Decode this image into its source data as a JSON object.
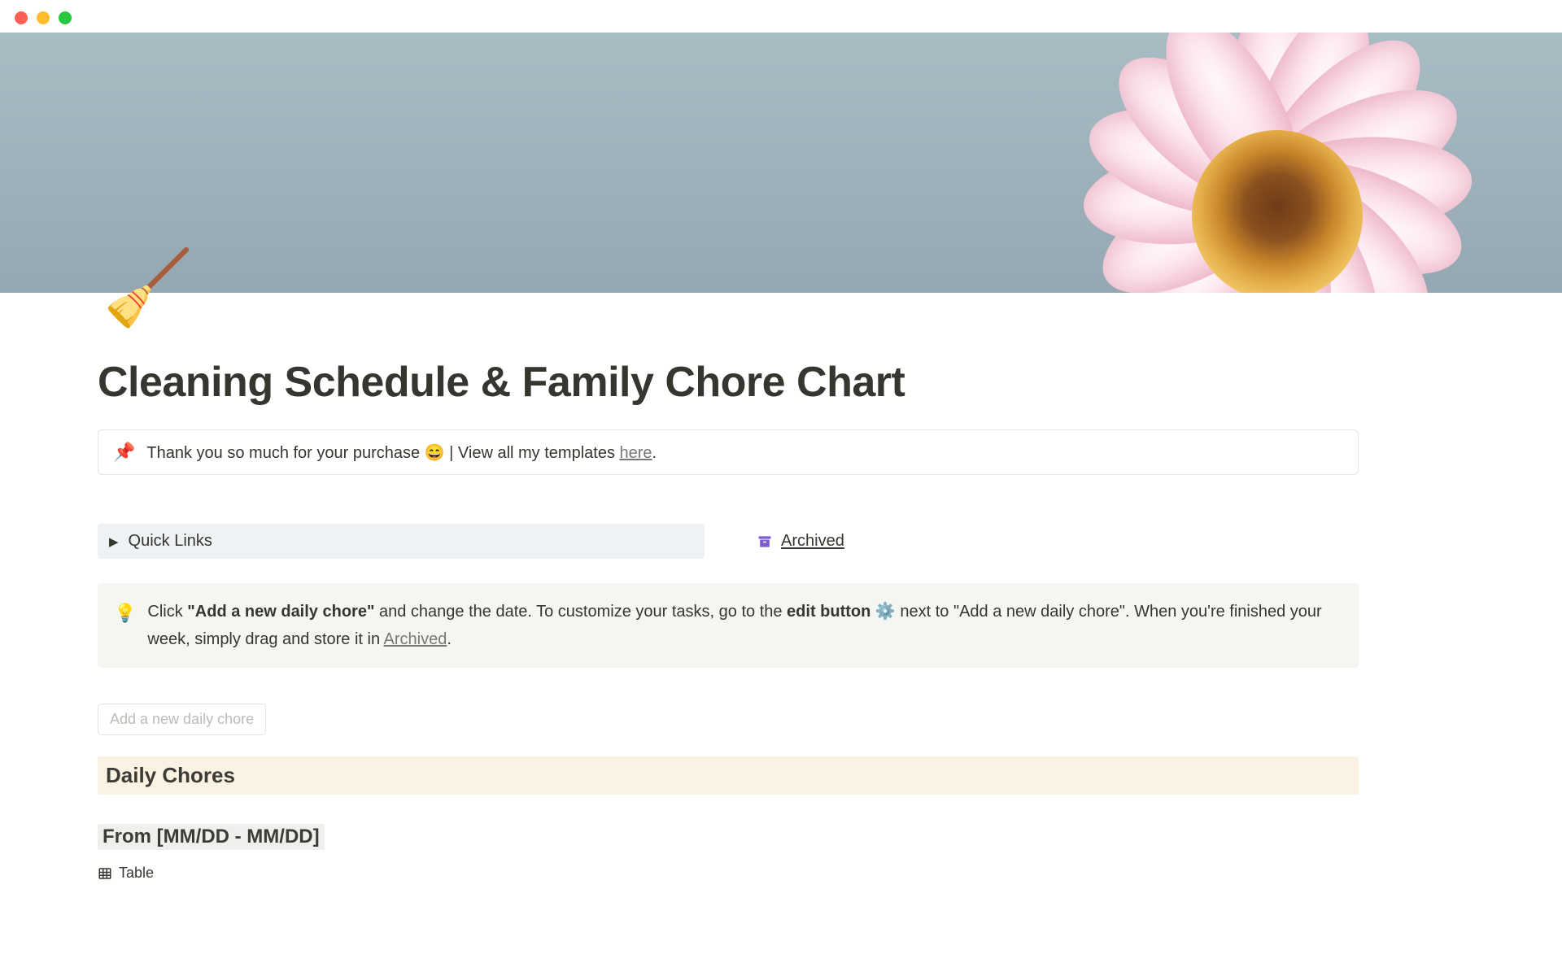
{
  "page_icon_emoji": "🧹",
  "title": "Cleaning Schedule & Family Chore Chart",
  "pin_callout": {
    "pin_emoji": "📌",
    "text_before": "Thank you so much for your purchase ",
    "smiley_emoji": "😄",
    "text_after": " | View all my templates ",
    "link_text": "here",
    "trailing_punct": "."
  },
  "quick_links": {
    "arrow_glyph": "▶",
    "label": "Quick Links"
  },
  "archived_link": {
    "label": "Archived"
  },
  "tip": {
    "bulb_emoji": "💡",
    "part1": "Click ",
    "bold1": "\"Add a new daily chore\"",
    "part2": " and change the date. To customize your tasks, go to the",
    "bold2": " edit button ",
    "gear_emoji": "⚙️",
    "part3": " next to \"Add a new daily chore\". When you're finished your week, simply drag and store it in ",
    "archived_link": "Archived",
    "trailing_punct": "."
  },
  "add_button": "Add a new daily chore",
  "daily_heading": "Daily Chores",
  "date_range": "From [MM/DD - MM/DD]",
  "table_switch": "Table"
}
